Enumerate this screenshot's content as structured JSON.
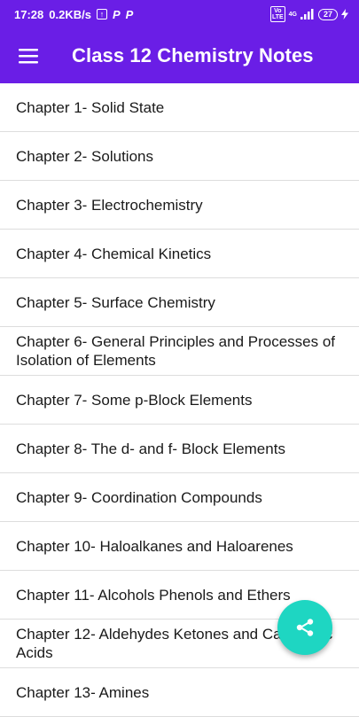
{
  "status_bar": {
    "time": "17:28",
    "net_speed": "0.2KB/s",
    "signal": "4G",
    "volte": "Vo LTE",
    "battery": "27"
  },
  "app_bar": {
    "title": "Class 12 Chemistry Notes",
    "menu_icon": "hamburger-menu-icon"
  },
  "chapters": [
    "Chapter 1- Solid State",
    "Chapter 2- Solutions",
    "Chapter 3- Electrochemistry",
    "Chapter 4- Chemical Kinetics",
    "Chapter 5- Surface Chemistry",
    "Chapter 6- General Principles and Processes of Isolation of Elements",
    "Chapter 7- Some p-Block Elements",
    "Chapter 8- The d- and f- Block Elements",
    "Chapter 9- Coordination Compounds",
    "Chapter 10- Haloalkanes and Haloarenes",
    "Chapter 11- Alcohols Phenols and Ethers",
    "Chapter 12- Aldehydes Ketones and Carboxylic Acids",
    "Chapter 13- Amines"
  ],
  "fab": {
    "icon": "share-icon",
    "color": "#1ed6c2"
  },
  "colors": {
    "primary": "#6a1ee6",
    "divider": "#dddddd"
  }
}
